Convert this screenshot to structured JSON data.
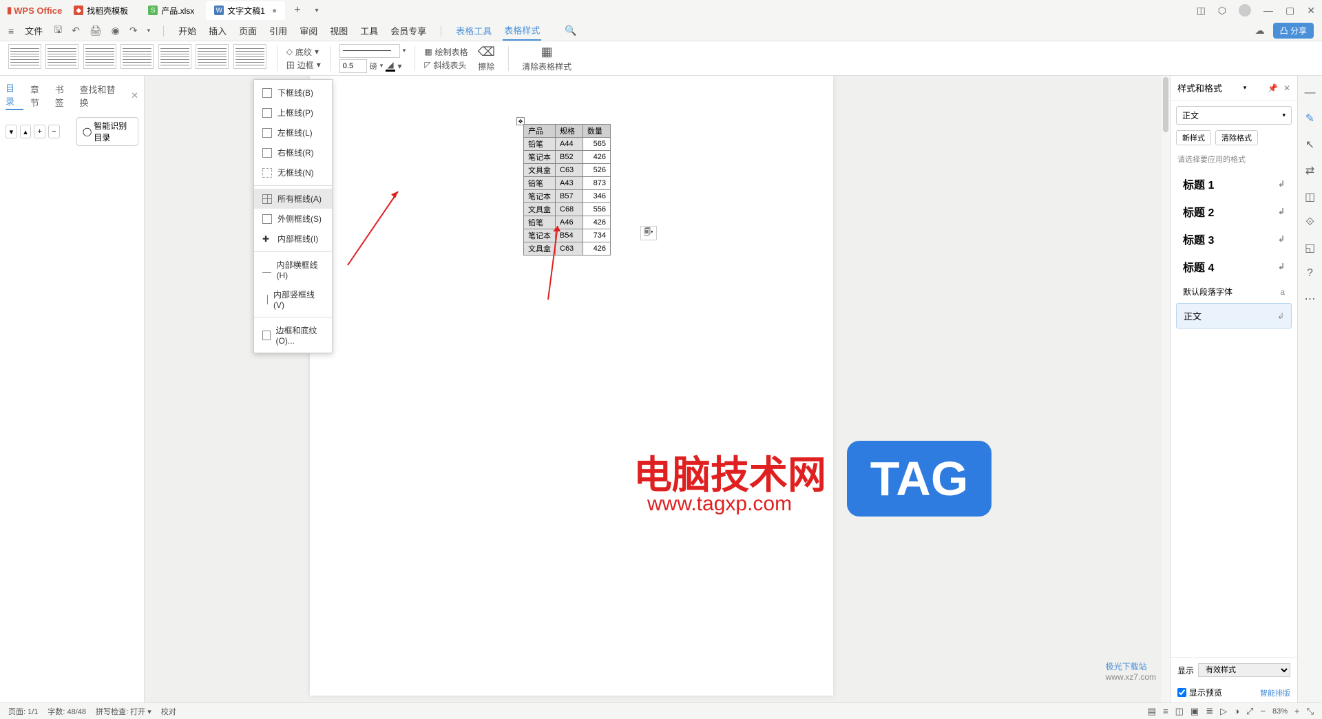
{
  "titlebar": {
    "logo": "WPS Office",
    "tabs": [
      {
        "icon": "red",
        "label": "找稻壳模板"
      },
      {
        "icon": "green",
        "label": "产品.xlsx"
      },
      {
        "icon": "blue",
        "label": "文字文稿1",
        "active": true,
        "dirty": "●"
      }
    ],
    "new": "+"
  },
  "quickbar": {
    "file": "文件"
  },
  "menu": {
    "items": [
      "开始",
      "插入",
      "页面",
      "引用",
      "审阅",
      "视图",
      "工具",
      "会员专享"
    ],
    "extra": [
      "表格工具",
      "表格样式"
    ],
    "share": "分享"
  },
  "ribbon": {
    "shading": "底纹",
    "border": "边框",
    "line_width": "0.5",
    "line_unit": "磅",
    "draw_table": "绘制表格",
    "diagonal": "斜线表头",
    "erase": "擦除",
    "clear_style": "清除表格样式"
  },
  "border_menu": [
    "下框线(B)",
    "上框线(P)",
    "左框线(L)",
    "右框线(R)",
    "无框线(N)",
    "所有框线(A)",
    "外侧框线(S)",
    "内部框线(I)",
    "内部横框线(H)",
    "内部竖框线(V)",
    "边框和底纹(O)..."
  ],
  "left_panel": {
    "tabs": [
      "目录",
      "章节",
      "书签",
      "查找和替换"
    ],
    "smart": "智能识别目录"
  },
  "table": {
    "headers": [
      "产品",
      "规格",
      "数量"
    ],
    "rows": [
      [
        "铅笔",
        "A44",
        "565"
      ],
      [
        "笔记本",
        "B52",
        "426"
      ],
      [
        "文具盒",
        "C63",
        "526"
      ],
      [
        "铅笔",
        "A43",
        "873"
      ],
      [
        "笔记本",
        "B57",
        "346"
      ],
      [
        "文具盒",
        "C68",
        "556"
      ],
      [
        "铅笔",
        "A46",
        "426"
      ],
      [
        "笔记本",
        "B54",
        "734"
      ],
      [
        "文具盒",
        "C63",
        "426"
      ]
    ]
  },
  "watermark": {
    "title": "电脑技术网",
    "url": "www.tagxp.com",
    "badge": "TAG",
    "corner": "极光下载站",
    "corner_url": "www.xz7.com"
  },
  "right_panel": {
    "title": "样式和格式",
    "current": "正文",
    "new_style": "新样式",
    "clear": "清除格式",
    "hint": "请选择要应用的格式",
    "styles": [
      "标题 1",
      "标题 2",
      "标题 3",
      "标题 4",
      "默认段落字体",
      "正文"
    ],
    "display": "显示",
    "display_val": "有效样式",
    "preview": "显示预览",
    "smart_layout": "智能排版"
  },
  "status": {
    "page": "页面: 1/1",
    "words": "字数: 48/48",
    "spell": "拼写检查: 打开",
    "proof": "校对",
    "zoom": "83%"
  }
}
